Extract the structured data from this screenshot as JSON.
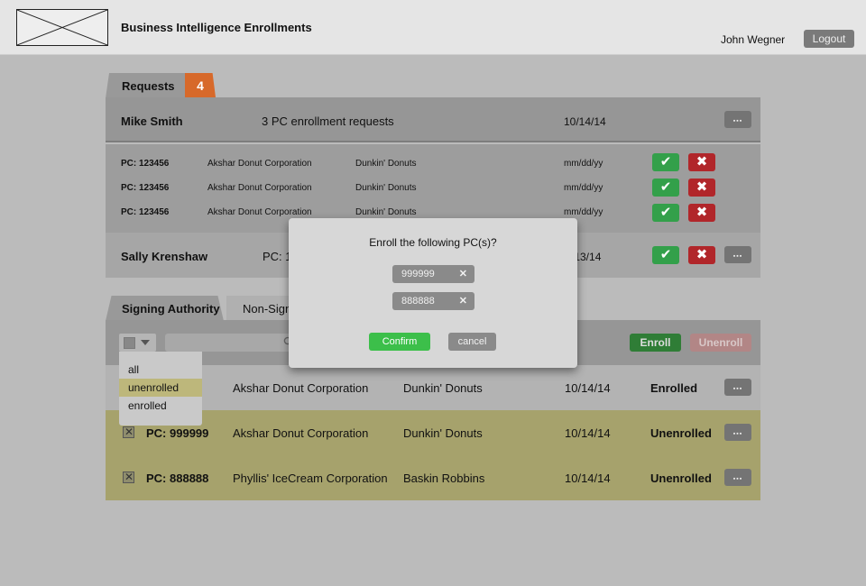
{
  "header": {
    "title": "Business Intelligence Enrollments",
    "user": "John Wegner",
    "logout": "Logout"
  },
  "requests_tab": {
    "label": "Requests",
    "count": "4"
  },
  "request_groups": [
    {
      "name": "Mike Smith",
      "summary": "3 PC enrollment requests",
      "date": "10/14/14",
      "items": [
        {
          "pc": "PC: 123456",
          "company": "Akshar Donut Corporation",
          "brand": "Dunkin' Donuts",
          "date": "mm/dd/yy"
        },
        {
          "pc": "PC: 123456",
          "company": "Akshar Donut Corporation",
          "brand": "Dunkin' Donuts",
          "date": "mm/dd/yy"
        },
        {
          "pc": "PC: 123456",
          "company": "Akshar Donut Corporation",
          "brand": "Dunkin' Donuts",
          "date": "mm/dd/yy"
        }
      ]
    },
    {
      "name": "Sally Krenshaw",
      "summary": "PC: 1",
      "date": "/13/14"
    }
  ],
  "tabs2": {
    "signing": "Signing Authority",
    "non_signing": "Non-Signin"
  },
  "toolbar": {
    "enroll": "Enroll",
    "unenroll": "Unenroll"
  },
  "filter_options": [
    "all",
    "unenrolled",
    "enrolled"
  ],
  "pc_rows": [
    {
      "pc": "3",
      "company": "Akshar Donut Corporation",
      "brand": "Dunkin' Donuts",
      "date": "10/14/14",
      "status": "Enrolled"
    },
    {
      "pc": "PC: 999999",
      "company": "Akshar Donut Corporation",
      "brand": "Dunkin' Donuts",
      "date": "10/14/14",
      "status": "Unenrolled"
    },
    {
      "pc": "PC: 888888",
      "company": "Phyllis' IceCream Corporation",
      "brand": "Baskin Robbins",
      "date": "10/14/14",
      "status": "Unenrolled"
    }
  ],
  "modal": {
    "title": "Enroll the following PC(s)?",
    "chips": [
      "999999",
      "888888"
    ],
    "remove_glyph": "✕",
    "confirm": "Confirm",
    "cancel": "cancel"
  },
  "glyphs": {
    "more": "▪▪▪",
    "check": "✔",
    "reject": "✖",
    "checkbox_x": "✕"
  },
  "colors": {
    "badge": "#d7692a",
    "approve": "#33a04a",
    "reject": "#b1262a",
    "highlight_row": "#a6a26c",
    "confirm": "#3cbf4a"
  }
}
